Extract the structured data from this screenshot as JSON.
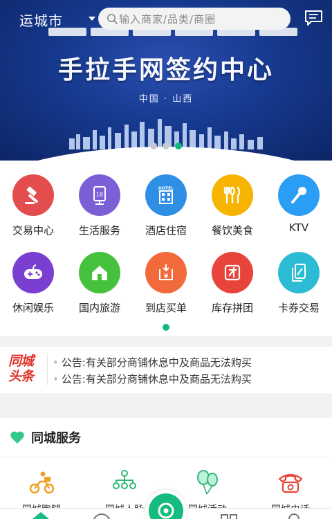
{
  "header": {
    "city": "运城市",
    "search_placeholder": "输入商家/品类/商圈"
  },
  "banner": {
    "title": "手拉手网签约中心",
    "subtitle": "中国 · 山西",
    "slide_count": 3,
    "active_slide": 3
  },
  "categories": [
    {
      "label": "交易中心",
      "icon": "gavel-icon",
      "color": "#e34d4d"
    },
    {
      "label": "生活服务",
      "icon": "life-service-icon",
      "color": "#7b5fd6"
    },
    {
      "label": "酒店住宿",
      "icon": "hotel-icon",
      "color": "#2f8fe4"
    },
    {
      "label": "餐饮美食",
      "icon": "food-icon",
      "color": "#f6b400"
    },
    {
      "label": "KTV",
      "icon": "microphone-icon",
      "color": "#2a9df4"
    },
    {
      "label": "休闲娱乐",
      "icon": "gamepad-icon",
      "color": "#7a3fd1"
    },
    {
      "label": "国内旅游",
      "icon": "house-icon",
      "color": "#46c13e"
    },
    {
      "label": "到店买单",
      "icon": "yuan-icon",
      "color": "#f26a3b"
    },
    {
      "label": "库存拼团",
      "icon": "group-buy-icon",
      "color": "#e8443b"
    },
    {
      "label": "卡券交易",
      "icon": "coupon-icon",
      "color": "#2bbcd4"
    }
  ],
  "news": {
    "logo_line1": "同城",
    "logo_line2": "头条",
    "items": [
      "公告:有关部分商铺休息中及商品无法购买",
      "公告:有关部分商铺休息中及商品无法购买"
    ]
  },
  "service": {
    "title": "同城服务",
    "items": [
      {
        "label": "同城跑腿",
        "icon": "courier-icon",
        "color": "#f0a020"
      },
      {
        "label": "同城人脉",
        "icon": "network-icon",
        "color": "#2fb87a"
      },
      {
        "label": "同城活动",
        "icon": "balloon-icon",
        "color": "#2fb87a"
      },
      {
        "label": "同城电话",
        "icon": "phone-icon",
        "color": "#e8443b"
      }
    ]
  },
  "colors": {
    "accent": "#16bb7f",
    "banner_bg": "#163a8f"
  }
}
